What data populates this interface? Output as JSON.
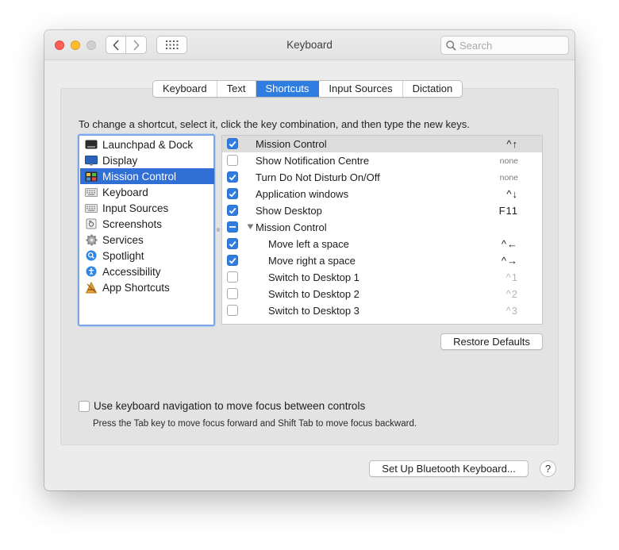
{
  "window": {
    "title": "Keyboard",
    "search_placeholder": "Search"
  },
  "tabs": [
    {
      "label": "Keyboard",
      "active": false
    },
    {
      "label": "Text",
      "active": false
    },
    {
      "label": "Shortcuts",
      "active": true
    },
    {
      "label": "Input Sources",
      "active": false
    },
    {
      "label": "Dictation",
      "active": false
    }
  ],
  "instructions": "To change a shortcut, select it, click the key combination, and then type the new keys.",
  "categories": [
    {
      "label": "Launchpad & Dock",
      "icon": "launchpad-icon",
      "selected": false
    },
    {
      "label": "Display",
      "icon": "display-icon",
      "selected": false
    },
    {
      "label": "Mission Control",
      "icon": "mission-control-icon",
      "selected": true
    },
    {
      "label": "Keyboard",
      "icon": "keyboard-icon",
      "selected": false
    },
    {
      "label": "Input Sources",
      "icon": "input-sources-icon",
      "selected": false
    },
    {
      "label": "Screenshots",
      "icon": "screenshots-icon",
      "selected": false
    },
    {
      "label": "Services",
      "icon": "gear-icon",
      "selected": false
    },
    {
      "label": "Spotlight",
      "icon": "spotlight-icon",
      "selected": false
    },
    {
      "label": "Accessibility",
      "icon": "accessibility-icon",
      "selected": false
    },
    {
      "label": "App Shortcuts",
      "icon": "app-shortcuts-icon",
      "selected": false
    }
  ],
  "shortcuts": [
    {
      "label": "Mission Control",
      "keys": "^↑",
      "state": "on",
      "selected": true,
      "indent": false,
      "group": false,
      "keys_style": "normal"
    },
    {
      "label": "Show Notification Centre",
      "keys": "none",
      "state": "off",
      "selected": false,
      "indent": false,
      "group": false,
      "keys_style": "none"
    },
    {
      "label": "Turn Do Not Disturb On/Off",
      "keys": "none",
      "state": "on",
      "selected": false,
      "indent": false,
      "group": false,
      "keys_style": "none"
    },
    {
      "label": "Application windows",
      "keys": "^↓",
      "state": "on",
      "selected": false,
      "indent": false,
      "group": false,
      "keys_style": "normal"
    },
    {
      "label": "Show Desktop",
      "keys": "F11",
      "state": "on",
      "selected": false,
      "indent": false,
      "group": false,
      "keys_style": "normal"
    },
    {
      "label": "Mission Control",
      "keys": "",
      "state": "mixed",
      "selected": false,
      "indent": false,
      "group": true,
      "keys_style": "normal"
    },
    {
      "label": "Move left a space",
      "keys": "^←",
      "state": "on",
      "selected": false,
      "indent": true,
      "group": false,
      "keys_style": "normal"
    },
    {
      "label": "Move right a space",
      "keys": "^→",
      "state": "on",
      "selected": false,
      "indent": true,
      "group": false,
      "keys_style": "normal"
    },
    {
      "label": "Switch to Desktop 1",
      "keys": "^1",
      "state": "off",
      "selected": false,
      "indent": true,
      "group": false,
      "keys_style": "dim"
    },
    {
      "label": "Switch to Desktop 2",
      "keys": "^2",
      "state": "off",
      "selected": false,
      "indent": true,
      "group": false,
      "keys_style": "dim"
    },
    {
      "label": "Switch to Desktop 3",
      "keys": "^3",
      "state": "off",
      "selected": false,
      "indent": true,
      "group": false,
      "keys_style": "dim"
    }
  ],
  "restore_defaults_label": "Restore Defaults",
  "keyboard_navigation": {
    "label": "Use keyboard navigation to move focus between controls",
    "checked": false,
    "hint": "Press the Tab key to move focus forward and Shift Tab to move focus backward."
  },
  "bluetooth_button_label": "Set Up Bluetooth Keyboard...",
  "help_label": "?",
  "colors": {
    "accent": "#2f7de1",
    "selection": "#2f6fd6"
  }
}
